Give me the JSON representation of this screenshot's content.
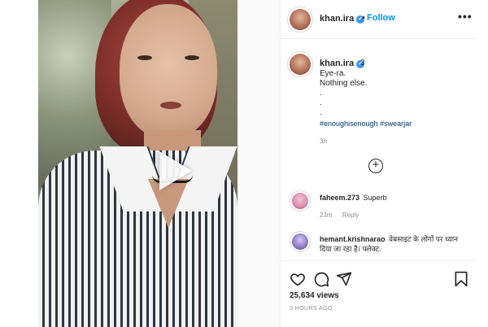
{
  "post": {
    "username": "khan.ira",
    "follow_label": "Follow",
    "separator": "•",
    "more_label": "•••",
    "verified_mark": "✓"
  },
  "caption": {
    "username": "khan.ira",
    "time": "3 ",
    "lines": [
      "Eye-ra.",
      "Nothing else.",
      ".",
      ".",
      "."
    ],
    "hashtags": "#enoughisenough #swearjar",
    "ago": "3h"
  },
  "load_more_label": "+",
  "comments": [
    {
      "username": "faheem.273",
      "text": "Superb",
      "time": "23m",
      "reply_label": "Reply"
    },
    {
      "username": "hemant.krishnarao",
      "text": "वेबसाइट के लोगों पर ध्यान दिया जा रहा है। फ्लेक्ट."
    }
  ],
  "stats": {
    "views": "25,634 views",
    "posted": "3 HOURS AGO"
  },
  "icons": {
    "like": "heart-icon",
    "comment": "comment-icon",
    "share": "paper-plane-icon",
    "save": "bookmark-icon",
    "play": "play-icon"
  },
  "colors": {
    "accent": "#0095f6",
    "verified": "#3897f0",
    "hashtag": "#00376b",
    "muted": "#8e8e8e"
  }
}
